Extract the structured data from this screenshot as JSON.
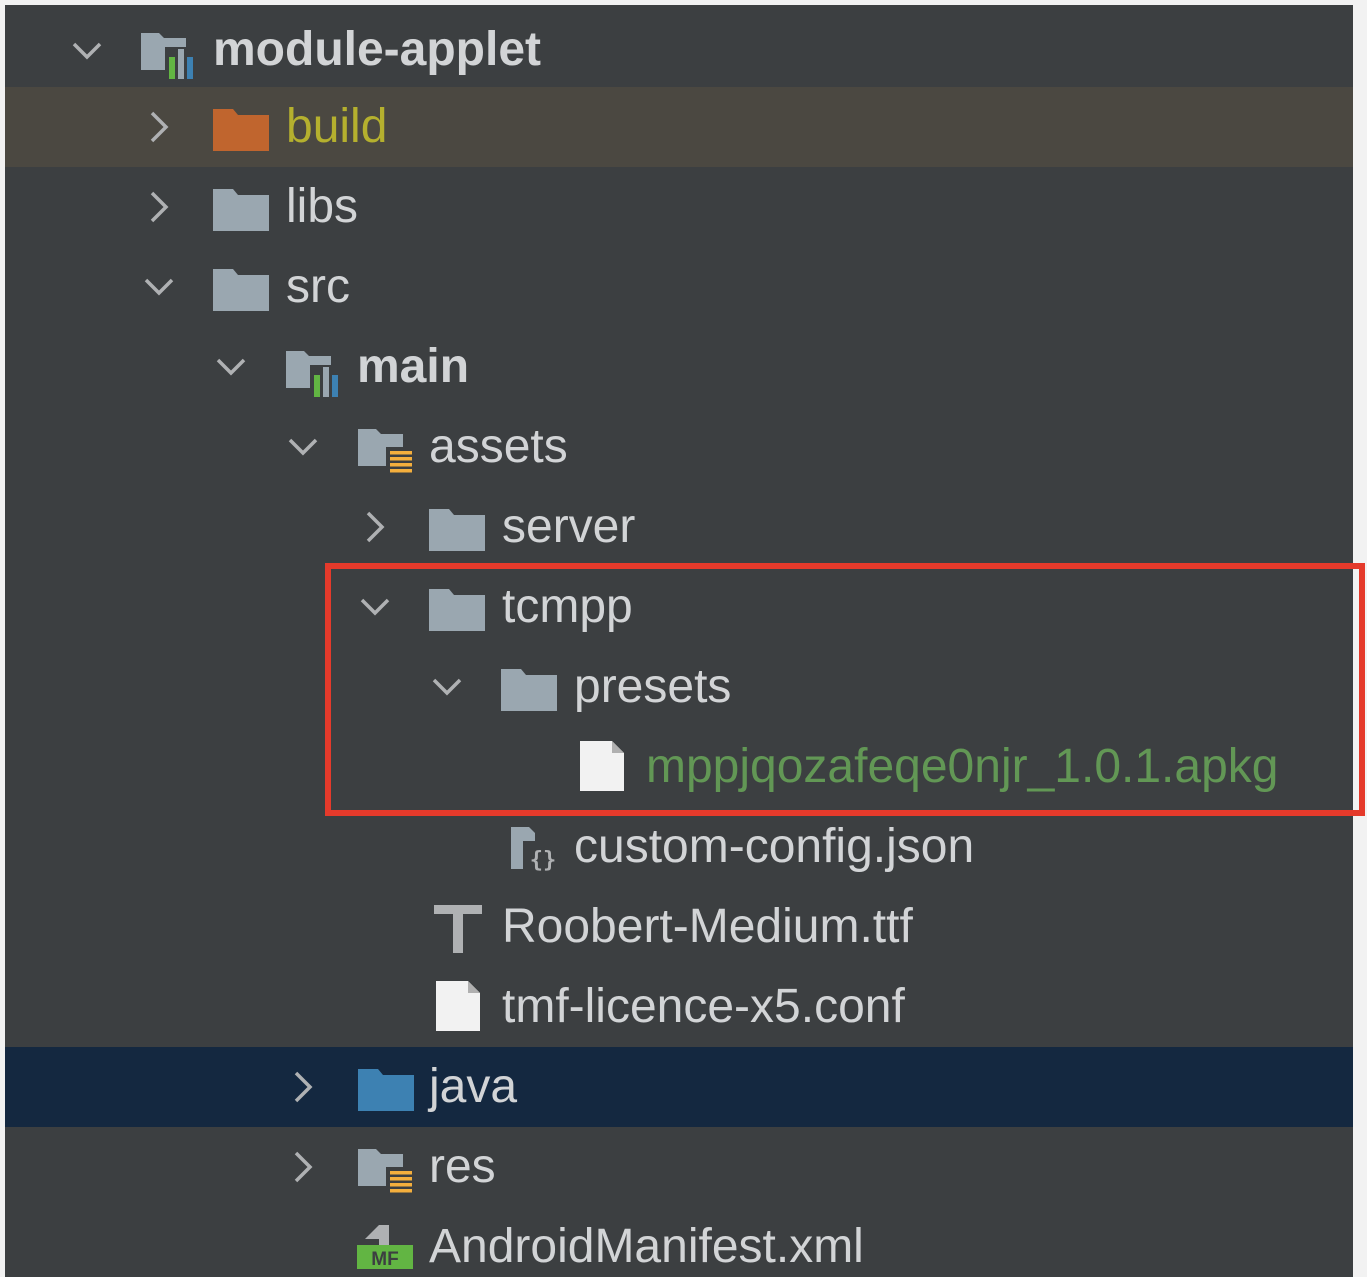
{
  "tree": {
    "nodes": [
      {
        "label": "module-applet",
        "icon": "module-folder-icon",
        "state": "expanded",
        "bold": true
      },
      {
        "label": "build",
        "icon": "excluded-folder-icon",
        "state": "collapsed",
        "style": "excluded"
      },
      {
        "label": "libs",
        "icon": "folder-icon",
        "state": "collapsed"
      },
      {
        "label": "src",
        "icon": "folder-icon",
        "state": "expanded"
      },
      {
        "label": "main",
        "icon": "module-folder-icon",
        "state": "expanded",
        "bold": true
      },
      {
        "label": "assets",
        "icon": "resource-folder-icon",
        "state": "expanded"
      },
      {
        "label": "server",
        "icon": "folder-icon",
        "state": "collapsed"
      },
      {
        "label": "tcmpp",
        "icon": "folder-icon",
        "state": "expanded"
      },
      {
        "label": "presets",
        "icon": "folder-icon",
        "state": "expanded"
      },
      {
        "label": "mppjqozafeqe0njr_1.0.1.apkg",
        "icon": "file-icon",
        "style": "vcs-added"
      },
      {
        "label": "custom-config.json",
        "icon": "json-file-icon"
      },
      {
        "label": "Roobert-Medium.ttf",
        "icon": "font-file-icon"
      },
      {
        "label": "tmf-licence-x5.conf",
        "icon": "file-icon"
      },
      {
        "label": "java",
        "icon": "source-folder-icon",
        "state": "collapsed",
        "selected": true
      },
      {
        "label": "res",
        "icon": "resource-folder-icon",
        "state": "collapsed"
      },
      {
        "label": "AndroidManifest.xml",
        "icon": "manifest-file-icon"
      }
    ]
  },
  "colors": {
    "panel_background": "#3c3f41",
    "text": "#d2d4d6",
    "excluded_row": "#4b4841",
    "excluded_text": "#b5b02e",
    "selected_row": "#142840",
    "vcs_added_text": "#629755",
    "highlight_border": "#e53a2b",
    "folder": "#9aa7b0",
    "excluded_folder": "#c0652e",
    "source_folder": "#3d81b2"
  },
  "annotation": {
    "highlight": "red rectangle around tcmpp / presets / mppjqozafeqe0njr_1.0.1.apkg"
  }
}
